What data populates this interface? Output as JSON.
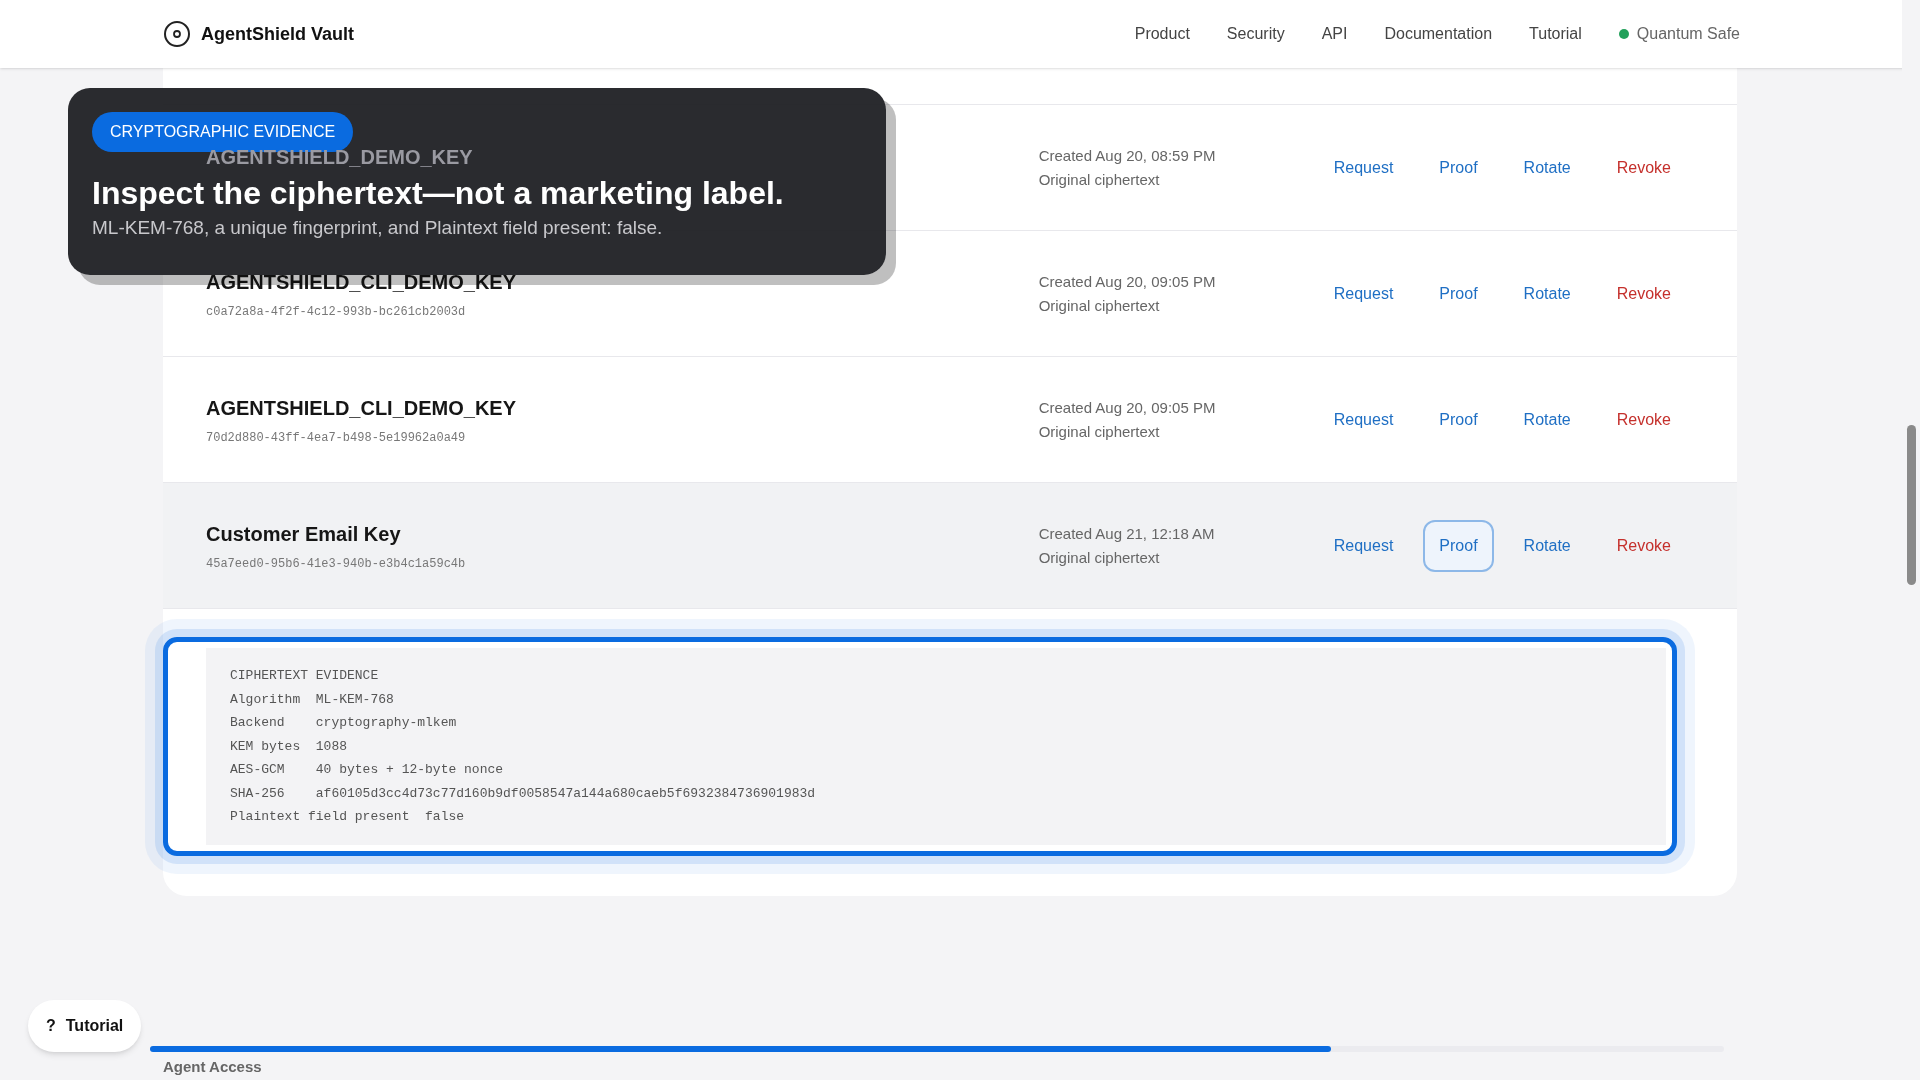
{
  "header": {
    "brand": "AgentShield Vault",
    "nav": [
      {
        "label": "Product"
      },
      {
        "label": "Security"
      },
      {
        "label": "API"
      },
      {
        "label": "Documentation"
      },
      {
        "label": "Tutorial"
      }
    ],
    "status": {
      "label": "Quantum Safe",
      "color": "#22a05a"
    }
  },
  "keys": [
    {
      "name": "AGENTSHIELD_DEMO_KEY",
      "created": "Created Aug 20, 08:59 PM",
      "source": "Original ciphertext",
      "selected": false,
      "actions": [
        {
          "label": "Request",
          "kind": "link",
          "selected": false
        },
        {
          "label": "Proof",
          "kind": "link",
          "selected": false
        },
        {
          "label": "Rotate",
          "kind": "link",
          "selected": false
        },
        {
          "label": "Revoke",
          "kind": "danger",
          "selected": false
        }
      ]
    },
    {
      "name": "AGENTSHIELD_CLI_DEMO_KEY",
      "id": "c0a72a8a-4f2f-4c12-993b-bc261cb2003d",
      "created": "Created Aug 20, 09:05 PM",
      "source": "Original ciphertext",
      "selected": false,
      "actions": [
        {
          "label": "Request",
          "kind": "link",
          "selected": false
        },
        {
          "label": "Proof",
          "kind": "link",
          "selected": false
        },
        {
          "label": "Rotate",
          "kind": "link",
          "selected": false
        },
        {
          "label": "Revoke",
          "kind": "danger",
          "selected": false
        }
      ]
    },
    {
      "name": "AGENTSHIELD_CLI_DEMO_KEY",
      "id": "70d2d880-43ff-4ea7-b498-5e19962a0a49",
      "created": "Created Aug 20, 09:05 PM",
      "source": "Original ciphertext",
      "selected": false,
      "actions": [
        {
          "label": "Request",
          "kind": "link",
          "selected": false
        },
        {
          "label": "Proof",
          "kind": "link",
          "selected": false
        },
        {
          "label": "Rotate",
          "kind": "link",
          "selected": false
        },
        {
          "label": "Revoke",
          "kind": "danger",
          "selected": false
        }
      ]
    },
    {
      "name": "Customer Email Key",
      "id": "45a7eed0-95b6-41e3-940b-e3b4c1a59c4b",
      "created": "Created Aug 21, 12:18 AM",
      "source": "Original ciphertext",
      "selected": true,
      "actions": [
        {
          "label": "Request",
          "kind": "link",
          "selected": false
        },
        {
          "label": "Proof",
          "kind": "link",
          "selected": true
        },
        {
          "label": "Rotate",
          "kind": "link",
          "selected": false
        },
        {
          "label": "Revoke",
          "kind": "danger",
          "selected": false
        }
      ]
    }
  ],
  "evidence": {
    "title": "CIPHERTEXT EVIDENCE",
    "lines": [
      {
        "label": "Algorithm ",
        "value": "ML-KEM-768"
      },
      {
        "label": "Backend   ",
        "value": "cryptography-mlkem"
      },
      {
        "label": "KEM bytes ",
        "value": "1088"
      },
      {
        "label": "AES-GCM   ",
        "value": "40 bytes + 12-byte nonce"
      },
      {
        "label": "SHA-256   ",
        "value": "af60105d3cc4d73c77d160b9df0058547a144a680caeb5f6932384736901983d"
      },
      {
        "label": "Plaintext field present ",
        "value": "false"
      }
    ]
  },
  "callout": {
    "badge": "CRYPTOGRAPHIC EVIDENCE",
    "title": "Inspect the ciphertext—not a marketing label.",
    "body": "ML-KEM-768, a unique fingerprint, and Plaintext field present: false."
  },
  "progress": {
    "level": 0.75
  },
  "tutorial_button": {
    "icon": "?",
    "label": "Tutorial"
  },
  "next_section": {
    "title": "Agent Access"
  }
}
